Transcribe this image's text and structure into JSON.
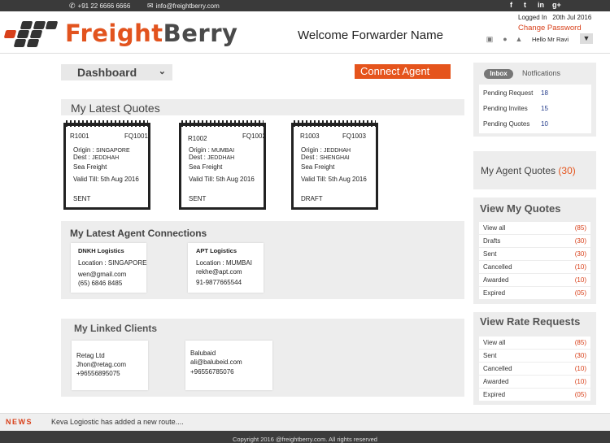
{
  "topbar": {
    "phone": "+91 22 6666 6666",
    "email": "info@freightberry.com",
    "social": [
      "f",
      "t",
      "in",
      "g+"
    ]
  },
  "header": {
    "brand_part1": "Freight",
    "brand_part2": "Berry",
    "welcome": "Welcome Forwarder Name",
    "logged_in_label": "Logged In",
    "logged_in_date": "20th Jul 2016",
    "change_password": "Change Password",
    "hello": "Hello Mr Ravi"
  },
  "dashboard": {
    "label": "Dashboard"
  },
  "connect_agent": "Connect Agent",
  "quotes": {
    "title": "My Latest Quotes",
    "items": [
      {
        "ref": "R1001",
        "fq": "FQ1001",
        "origin_label": "Origin :",
        "origin": "SINGAPORE",
        "dest_label": "Dest  :",
        "dest": "JEDDHAH",
        "mode": "Sea Freight",
        "valid": "Valid Till: 5th Aug 2016",
        "status": "SENT"
      },
      {
        "ref": "R1002",
        "fq": "FQ1002",
        "origin_label": "Origin :",
        "origin": "MUMBAI",
        "dest_label": "Dest  :",
        "dest": "JEDDHAH",
        "mode": "Sea Freight",
        "valid": "Valid Till: 5th Aug 2016",
        "status": "SENT"
      },
      {
        "ref": "R1003",
        "fq": "FQ1003",
        "origin_label": "Origin :",
        "origin": "JEDDHAH",
        "dest_label": "Dest  :",
        "dest": "SHENGHAI",
        "mode": "Sea Freight",
        "valid": "Valid Till: 5th Aug 2016",
        "status": "DRAFT"
      }
    ]
  },
  "connections": {
    "title": "My Latest Agent Connections",
    "items": [
      {
        "name": "DNKH Logistics",
        "location": "Location : SINGAPORE",
        "email": "wen@gmail.com",
        "phone": "(65)  6846 8485"
      },
      {
        "name": "APT Logistics",
        "location": "Location : MUMBAI",
        "email": "rekhe@apt.com",
        "phone": "91-9877665544"
      }
    ]
  },
  "clients": {
    "title": "My Linked Clients",
    "items": [
      {
        "name": "Retag Ltd",
        "email": "Jhon@retag.com",
        "phone": "+96556895075"
      },
      {
        "name": "Balubaid",
        "email": "ali@balubeid.com",
        "phone": "+96556785076"
      }
    ]
  },
  "inbox": {
    "tab_inbox": "Inbox",
    "tab_notifications": "Notfications",
    "rows": [
      {
        "label": "Pending Request",
        "value": "18"
      },
      {
        "label": "Pending Invites",
        "value": "15"
      },
      {
        "label": "Pending Quotes",
        "value": "10"
      }
    ]
  },
  "agent_quotes": {
    "label": "My Agent Quotes",
    "count": "(30)"
  },
  "view_quotes": {
    "title": "View My Quotes",
    "rows": [
      {
        "label": "View all",
        "value": "(85)"
      },
      {
        "label": "Drafts",
        "value": "(30)"
      },
      {
        "label": "Sent",
        "value": "(30)"
      },
      {
        "label": "Cancelled",
        "value": "(10)"
      },
      {
        "label": "Awarded",
        "value": "(10)"
      },
      {
        "label": "Expired",
        "value": "(05)"
      }
    ]
  },
  "rate_requests": {
    "title": "View  Rate Requests",
    "rows": [
      {
        "label": "View all",
        "value": "(85)"
      },
      {
        "label": "Sent",
        "value": "(30)"
      },
      {
        "label": "Cancelled",
        "value": "(10)"
      },
      {
        "label": "Awarded",
        "value": "(10)"
      },
      {
        "label": "Expired",
        "value": "(05)"
      }
    ]
  },
  "news": {
    "label": "NEWS",
    "text": "Keva Logiostic has added a new route...."
  },
  "footer": {
    "copyright": "Copyright 2016 @freightberry.com. All rights reserved"
  },
  "colors": {
    "accent": "#e5541c",
    "dark": "#3a3a3a",
    "panel": "#ededed"
  }
}
